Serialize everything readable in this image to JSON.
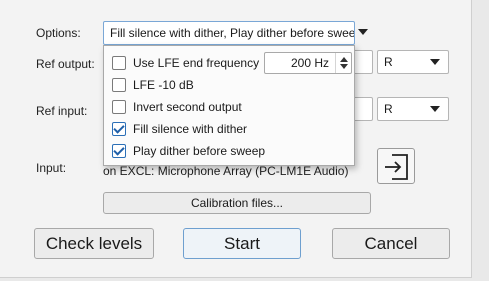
{
  "labels": {
    "options": "Options:",
    "ref_output": "Ref output:",
    "ref_input": "Ref input:",
    "input": "Input:"
  },
  "options_combo": {
    "value": "Fill silence with dither, Play dither before swee"
  },
  "ref_output_channel": {
    "value": "R"
  },
  "ref_input_channel": {
    "value": "R"
  },
  "dropdown": {
    "items": [
      {
        "label": "Use LFE end frequency",
        "checked": false
      },
      {
        "label": "LFE -10 dB",
        "checked": false
      },
      {
        "label": "Invert second output",
        "checked": false
      },
      {
        "label": "Fill silence with dither",
        "checked": true
      },
      {
        "label": "Play dither before sweep",
        "checked": true
      }
    ],
    "lfe_frequency": "200 Hz"
  },
  "input_device": "on EXCL: Microphone Array (PC-LM1E Audio)",
  "buttons": {
    "calibration": "Calibration files...",
    "check_levels": "Check levels",
    "start": "Start",
    "cancel": "Cancel"
  },
  "icons": {
    "input_select": "enter-input-icon",
    "dropdown_caret": "chevron-down-icon",
    "spinner_up": "spin-up-icon",
    "spinner_down": "spin-down-icon"
  }
}
